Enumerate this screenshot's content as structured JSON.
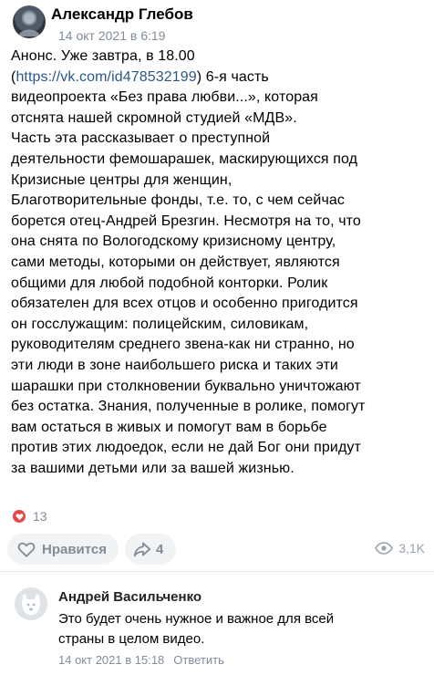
{
  "post": {
    "author": "Александр Глебов",
    "date": "14 окт 2021 в 6:19",
    "text_lines": [
      "Анонс. Уже завтра, в 18.00",
      "6-я часть",
      "видеопроекта «Без права любви...», которая",
      "отснята нашей скромной студией «МДВ».",
      "Часть эта рассказывает о преступной",
      "деятельности фемошарашек, маскирующихся под",
      "Кризисные центры для женщин,",
      "Благотворительные фонды, т.е. то, с чем сейчас",
      "борется отец-Андрей Брезгин. Несмотря на то, что",
      "она снята по Вологодскому кризисному центру,",
      "сами методы, которыми он действует, являются",
      "общими для любой подобной конторки. Ролик",
      "обязателен для всех отцов и особенно пригодится",
      "он госслужащим: полицейским, силовикам,",
      "руководителям среднего звена-как ни странно, но",
      "эти люди в зоне наибольшего риска и таких эти",
      "шарашки при столкновении буквально уничтожают",
      "без остатка. Знания, полученные в ролике, помогут",
      "вам остаться в живых и помогут вам в борьбе",
      "против этих людоедок, если не дай Бог они придут",
      "за вашими детьми или за вашей жизнью."
    ],
    "link_open": "(",
    "link_url": "https://vk.com/id478532199",
    "link_close": ")",
    "reactions_count": "13",
    "like_label": "Нравится",
    "share_count": "4",
    "views_count": "3,1K"
  },
  "comment": {
    "author": "Андрей Васильченко",
    "text_lines": [
      "Это будет очень нужное и важное для всей",
      "страны в целом видео."
    ],
    "date": "14 окт 2021 в 15:18",
    "reply_label": "Ответить"
  },
  "icons": {
    "like": "heart-outline-icon",
    "share": "share-arrow-icon",
    "views": "eye-icon",
    "reaction": "heart-filled-icon"
  },
  "colors": {
    "link": "#2a5885",
    "secondary_text": "#818c99",
    "pill_bg": "#f2f3f5",
    "reaction_red": "#e64646"
  }
}
